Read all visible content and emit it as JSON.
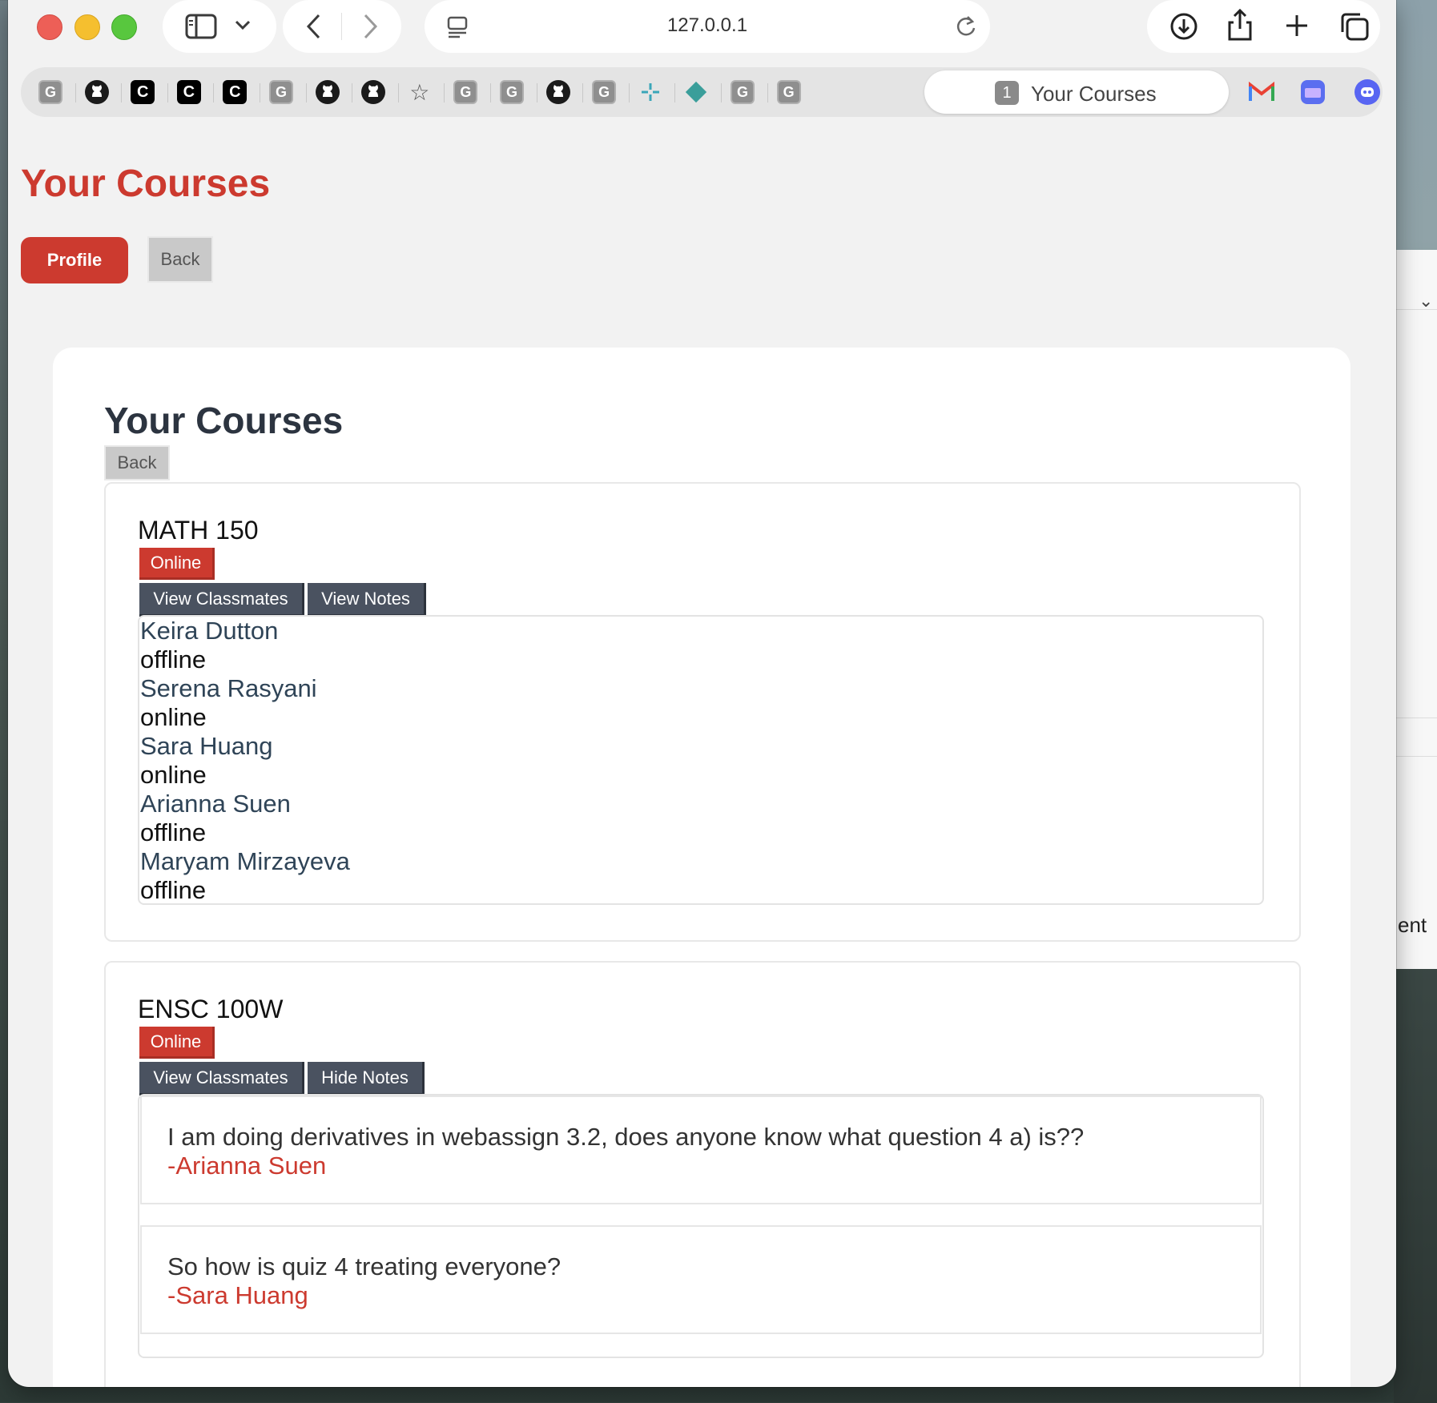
{
  "browser": {
    "url": "127.0.0.1",
    "tab": {
      "count": "1",
      "title": "Your Courses"
    },
    "favorites": [
      {
        "type": "g",
        "label": "G"
      },
      {
        "type": "gh",
        "label": "github"
      },
      {
        "type": "c",
        "label": "C"
      },
      {
        "type": "c",
        "label": "C"
      },
      {
        "type": "c",
        "label": "C"
      },
      {
        "type": "g",
        "label": "G"
      },
      {
        "type": "gh",
        "label": "github"
      },
      {
        "type": "gh",
        "label": "github"
      },
      {
        "type": "star",
        "label": "☆"
      },
      {
        "type": "g",
        "label": "G"
      },
      {
        "type": "g",
        "label": "G"
      },
      {
        "type": "gh",
        "label": "github"
      },
      {
        "type": "g",
        "label": "G"
      },
      {
        "type": "slack",
        "label": "slack"
      },
      {
        "type": "diamond",
        "label": "diamond"
      },
      {
        "type": "g",
        "label": "G"
      },
      {
        "type": "g",
        "label": "G"
      }
    ]
  },
  "page": {
    "title": "Your Courses",
    "profile_label": "Profile",
    "back_label": "Back"
  },
  "card": {
    "title": "Your Courses",
    "back_label": "Back"
  },
  "courses": [
    {
      "name": "MATH 150",
      "badge": "Online",
      "classmates_label": "View Classmates",
      "notes_label": "View Notes",
      "classmates": [
        {
          "name": "Keira Dutton",
          "status": "offline"
        },
        {
          "name": "Serena Rasyani",
          "status": "online"
        },
        {
          "name": "Sara Huang",
          "status": "online"
        },
        {
          "name": "Arianna Suen",
          "status": "offline"
        },
        {
          "name": "Maryam Mirzayeva",
          "status": "offline"
        }
      ]
    },
    {
      "name": "ENSC 100W",
      "badge": "Online",
      "classmates_label": "View Classmates",
      "notes_label": "Hide Notes",
      "notes": [
        {
          "text": "I am doing derivatives in webassign 3.2, does anyone know what question 4 a) is??",
          "author": "-Arianna Suen"
        },
        {
          "text": "So how is quiz 4 treating everyone?",
          "author": "-Sara Huang"
        }
      ]
    }
  ],
  "background_window": {
    "text": "ent"
  },
  "colors": {
    "accent": "#cc3a2f",
    "button_dark": "#4a5260",
    "heading": "#2c3440"
  }
}
